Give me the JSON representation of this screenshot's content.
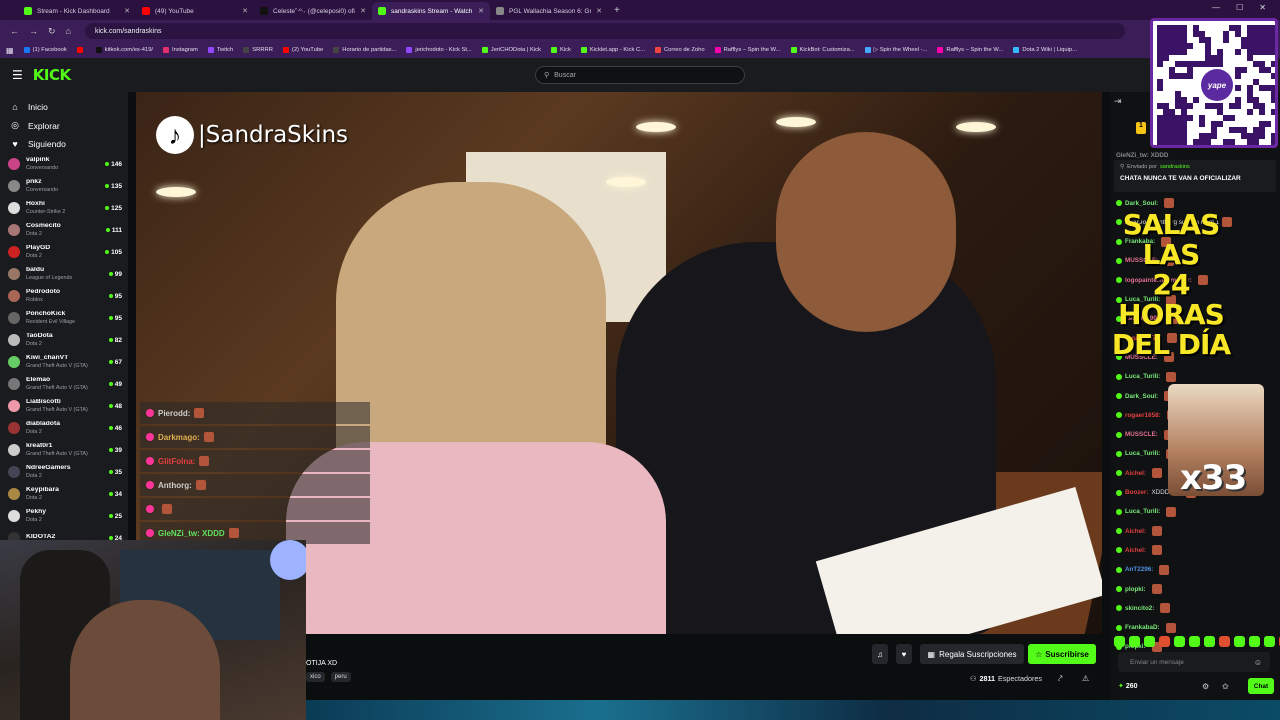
{
  "browser": {
    "tabs": [
      {
        "title": "Stream - Kick Dashboard",
        "color": "#53fc18",
        "active": false
      },
      {
        "title": "(49) YouTube",
        "color": "#ff0000",
        "active": false
      },
      {
        "title": "Celeste˚‧º·˖ (@celeposi0) ofi...",
        "color": "#111111",
        "active": false
      },
      {
        "title": "sandraskins Stream - Watch...",
        "color": "#53fc18",
        "active": true
      },
      {
        "title": "PGL Wallachia Season 6: Group...",
        "color": "#888888",
        "active": false
      }
    ],
    "url": "kick.com/sandraskins",
    "bookmarks": [
      {
        "label": "(1) Facebook",
        "color": "#1877f2"
      },
      {
        "label": "",
        "color": "#ff0000"
      },
      {
        "label": "kitkok.com/es-419/",
        "color": "#111111"
      },
      {
        "label": "Instagram",
        "color": "#e1306c"
      },
      {
        "label": "Twitch",
        "color": "#9146ff"
      },
      {
        "label": "SRRRR",
        "color": "#444444"
      },
      {
        "label": "(2) YouTube",
        "color": "#ff0000"
      },
      {
        "label": "Horario de partidas...",
        "color": "#444444"
      },
      {
        "label": "jerichodoto - Kick St...",
        "color": "#9146ff"
      },
      {
        "label": "JeriCHODota | Kick",
        "color": "#53fc18"
      },
      {
        "label": "Kick",
        "color": "#53fc18"
      },
      {
        "label": "Kicklet.app - Kick C...",
        "color": "#53fc18"
      },
      {
        "label": "Correo de Zoho",
        "color": "#e44"
      },
      {
        "label": "Rafflys – Spin the W...",
        "color": "#f0a"
      },
      {
        "label": "KickBot: Customiza...",
        "color": "#53fc18"
      },
      {
        "label": "▷ Spin the Wheel -...",
        "color": "#4af"
      },
      {
        "label": "Rafflys – Spin the W...",
        "color": "#f0a"
      },
      {
        "label": "Dota 2 Wiki | Liquip...",
        "color": "#3bf"
      }
    ]
  },
  "kick": {
    "logo": "KICK",
    "search_placeholder": "Buscar",
    "nav": [
      {
        "icon": "home-icon",
        "glyph": "⌂",
        "label": "Inicio"
      },
      {
        "icon": "compass-icon",
        "glyph": "◎",
        "label": "Explorar"
      },
      {
        "icon": "heart-icon",
        "glyph": "♥",
        "label": "Siguiendo"
      }
    ],
    "following": [
      {
        "name": "valpink",
        "game": "Conversando",
        "viewers": "146",
        "color": "#c48"
      },
      {
        "name": "pnkz",
        "game": "Conversando",
        "viewers": "135",
        "color": "#888"
      },
      {
        "name": "Hoxhi",
        "game": "Counter-Strike 2",
        "viewers": "125",
        "color": "#ddd"
      },
      {
        "name": "Cosmecito",
        "game": "Dota 2",
        "viewers": "111",
        "color": "#a77"
      },
      {
        "name": "PlayGD",
        "game": "Dota 2",
        "viewers": "105",
        "color": "#c22"
      },
      {
        "name": "baldu",
        "game": "League of Legends",
        "viewers": "99",
        "color": "#976"
      },
      {
        "name": "Pedrodoto",
        "game": "Roblox",
        "viewers": "95",
        "color": "#a65"
      },
      {
        "name": "PonchoKick",
        "game": "Resident Evil Village",
        "viewers": "95",
        "color": "#666"
      },
      {
        "name": "TaoDota",
        "game": "Dota 2",
        "viewers": "82",
        "color": "#bbb"
      },
      {
        "name": "Kiwi_chanVT",
        "game": "Grand Theft Auto V (GTA)",
        "viewers": "67",
        "color": "#6c6"
      },
      {
        "name": "Elemao",
        "game": "Grand Theft Auto V (GTA)",
        "viewers": "49",
        "color": "#777"
      },
      {
        "name": "LiaBiscotti",
        "game": "Grand Theft Auto V (GTA)",
        "viewers": "48",
        "color": "#e9a"
      },
      {
        "name": "diabladota",
        "game": "Dota 2",
        "viewers": "46",
        "color": "#933"
      },
      {
        "name": "kreat0r1",
        "game": "Grand Theft Auto V (GTA)",
        "viewers": "39",
        "color": "#ccc"
      },
      {
        "name": "NdreeGamers",
        "game": "Dota 2",
        "viewers": "35",
        "color": "#445"
      },
      {
        "name": "Keypibara",
        "game": "Dota 2",
        "viewers": "34",
        "color": "#a84"
      },
      {
        "name": "Pekhy",
        "game": "Dota 2",
        "viewers": "25",
        "color": "#ddd"
      },
      {
        "name": "KIDOTA2",
        "game": "",
        "viewers": "24",
        "color": "#333"
      }
    ],
    "overlay": {
      "tiktok_name": "|SandraSkins",
      "chat": [
        {
          "user": "Pierodd:",
          "color": "#cccccc"
        },
        {
          "user": "Darkmago:",
          "color": "#e0b050"
        },
        {
          "user": "GlitFolna:",
          "color": "#e04040"
        },
        {
          "user": "Anthorg:",
          "color": "#cccccc"
        },
        {
          "user": "",
          "color": "#e04040"
        },
        {
          "user": "GleNZi_tw: XDDD",
          "color": "#60e060"
        }
      ]
    },
    "stream": {
      "title_fragment": "OTIJA XD",
      "tags": [
        "xico",
        "peru"
      ],
      "gift_label": "Regala Suscripciones",
      "subscribe_label": "Suscribirse",
      "viewers": "2811",
      "viewers_label": "Espectadores"
    },
    "chat": {
      "pinned_by_label": "Enviado por",
      "pinned_by_user": "sandraskins",
      "pinned_message": "CHATA NUNCA TE VAN A OFICIALIZAR",
      "top_fragment": "GleNZi_tw: XDDD",
      "messages": [
        {
          "user": "Dark_Soul:",
          "text": "",
          "color": "#7ae87a"
        },
        {
          "user": "BearJos:",
          "text": "Anthorg subió a nivel 1",
          "color": "#aaa"
        },
        {
          "user": "Frankaba:",
          "text": "",
          "color": "#7ae87a"
        },
        {
          "user": "MUSSCLE:",
          "text": "",
          "color": "#e07090"
        },
        {
          "user": "logopainternaumador:",
          "text": "",
          "color": "#e07090"
        },
        {
          "user": "Luca_Turili:",
          "text": "",
          "color": "#7ae87a"
        },
        {
          "user": "Leslie_1904:",
          "text": "",
          "color": "#e07090"
        },
        {
          "user": "rogaer1658:",
          "text": "",
          "color": "#e04040"
        },
        {
          "user": "MUSSCLE:",
          "text": "",
          "color": "#e07090"
        },
        {
          "user": "Luca_Turili:",
          "text": "",
          "color": "#7ae87a"
        },
        {
          "user": "Dark_Soul:",
          "text": "",
          "color": "#7ae87a"
        },
        {
          "user": "rogaer1658:",
          "text": "",
          "color": "#e04040"
        },
        {
          "user": "MUSSCLE:",
          "text": "",
          "color": "#e07090"
        },
        {
          "user": "Luca_Turili:",
          "text": "",
          "color": "#7ae87a"
        },
        {
          "user": "Aichel:",
          "text": "",
          "color": "#e04040"
        },
        {
          "user": "Boozer:",
          "text": "XDDDDDD",
          "color": "#e04040"
        },
        {
          "user": "Luca_Turili:",
          "text": "",
          "color": "#7ae87a"
        },
        {
          "user": "Aichel:",
          "text": "",
          "color": "#e04040"
        },
        {
          "user": "Aichel:",
          "text": "",
          "color": "#e04040"
        },
        {
          "user": "AnT2296:",
          "text": "",
          "color": "#5090e0"
        },
        {
          "user": "plopki:",
          "text": "",
          "color": "#7ae87a"
        },
        {
          "user": "skincito2:",
          "text": "",
          "color": "#7ae87a"
        },
        {
          "user": "FrankabaD:",
          "text": "",
          "color": "#7ae87a"
        },
        {
          "user": "plopki:",
          "text": "",
          "color": "#7ae87a"
        }
      ],
      "promo_line1": "SALAS LAS",
      "promo_line2": "24 HORAS",
      "promo_line3": "DEL DÍA",
      "meme_multiplier": "x33",
      "qr_brand": "yape",
      "input_placeholder": "Enviar un mensaje",
      "points": "260",
      "chat_button": "Chat"
    }
  }
}
